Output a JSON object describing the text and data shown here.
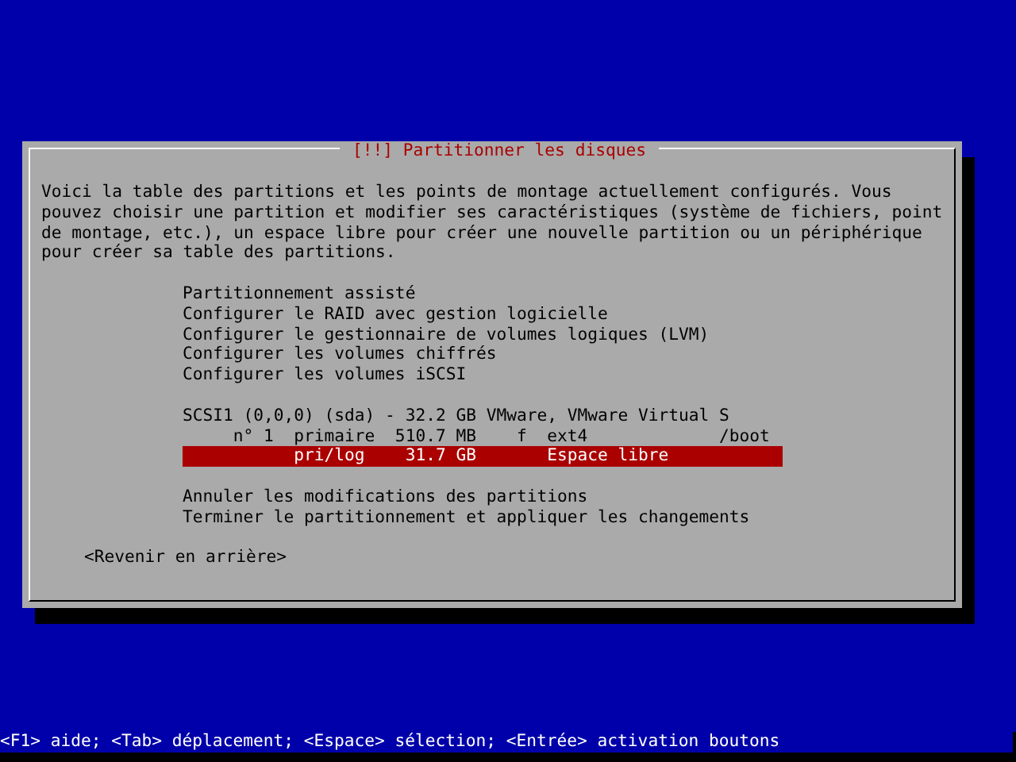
{
  "dialog": {
    "title": "[!!] Partitionner les disques",
    "description": "Voici la table des partitions et les points de montage actuellement configurés. Vous pouvez choisir une partition et modifier ses caractéristiques (système de fichiers, point de montage, etc.), un espace libre pour créer une nouvelle partition ou un périphérique pour créer sa table des partitions.",
    "groups": [
      [
        {
          "label": "Partitionnement assisté",
          "selected": false
        },
        {
          "label": "Configurer le RAID avec gestion logicielle",
          "selected": false
        },
        {
          "label": "Configurer le gestionnaire de volumes logiques (LVM)",
          "selected": false
        },
        {
          "label": "Configurer les volumes chiffrés",
          "selected": false
        },
        {
          "label": "Configurer les volumes iSCSI",
          "selected": false
        }
      ],
      [
        {
          "label": "SCSI1 (0,0,0) (sda) - 32.2 GB VMware, VMware Virtual S",
          "selected": false
        },
        {
          "label": "     n° 1  primaire  510.7 MB    f  ext4             /boot",
          "selected": false
        },
        {
          "label": "           pri/log    31.7 GB       Espace libre           ",
          "selected": true
        }
      ],
      [
        {
          "label": "Annuler les modifications des partitions",
          "selected": false
        },
        {
          "label": "Terminer le partitionnement et appliquer les changements",
          "selected": false
        }
      ]
    ],
    "back_button": "<Revenir en arrière>"
  },
  "status_bar": "<F1> aide; <Tab> déplacement; <Espace> sélection; <Entrée> activation boutons"
}
